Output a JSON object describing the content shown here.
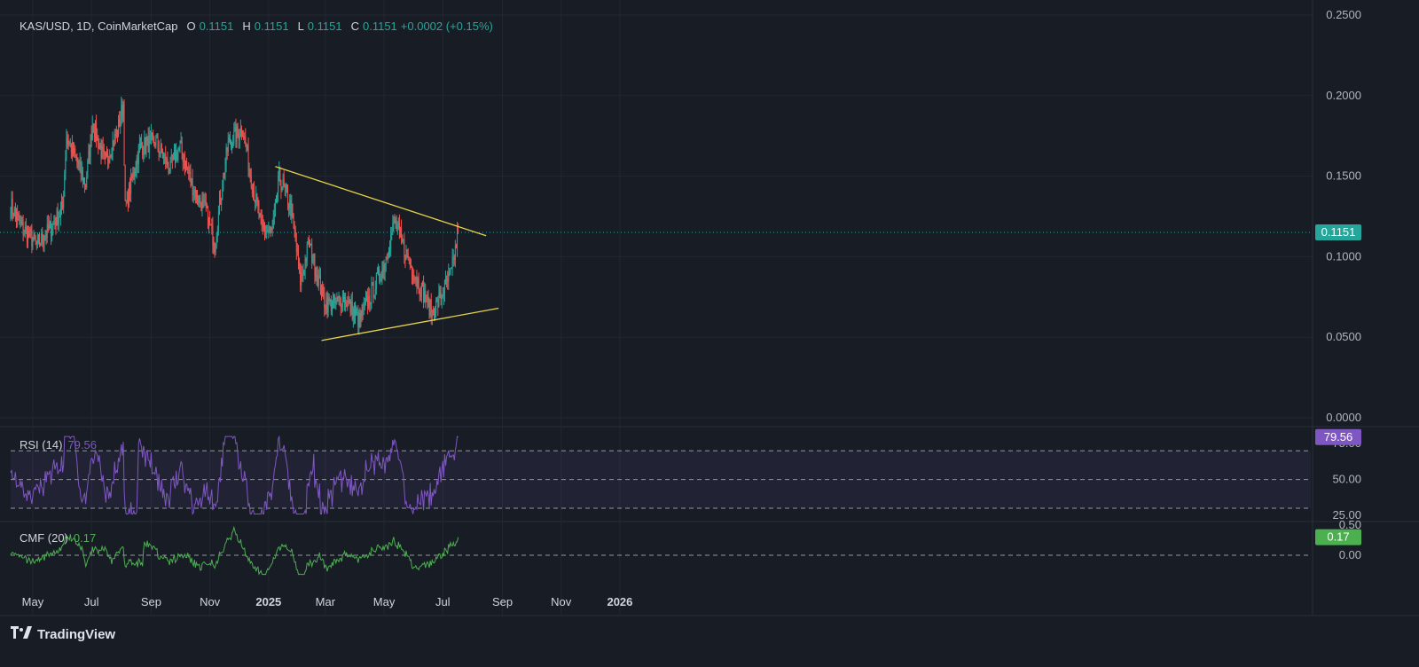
{
  "header": {
    "symbol": "KAS/USD, 1D, CoinMarketCap",
    "open_label": "O",
    "open": "0.1151",
    "high_label": "H",
    "high": "0.1151",
    "low_label": "L",
    "low": "0.1151",
    "close_label": "C",
    "close": "0.1151",
    "change": "+0.0002 (+0.15%)"
  },
  "colors": {
    "up": "#26a69a",
    "down": "#ef5350",
    "trendline": "#e5d34a",
    "rsi": "#7e57c2",
    "cmf": "#4caf50",
    "last_price": "#26a69a"
  },
  "footer": {
    "brand": "TradingView",
    "logo_icon": "tradingview-logo-icon"
  },
  "chart_data": [
    {
      "type": "candlestick",
      "title": "KAS/USD, 1D, CoinMarketCap",
      "y_ticks": [
        "0.2500",
        "0.2000",
        "0.1500",
        "0.1000",
        "0.0500",
        "0.0000"
      ],
      "ylim": [
        0,
        0.25
      ],
      "last_price_label": "0.1151",
      "x_ticks": [
        "May",
        "Jul",
        "Sep",
        "Nov",
        "2025",
        "Mar",
        "May",
        "Jul",
        "Sep",
        "Nov",
        "2026"
      ],
      "approx_close_path": [
        [
          "2024-04-08",
          0.132
        ],
        [
          "2024-04-20",
          0.118
        ],
        [
          "2024-05-05",
          0.107
        ],
        [
          "2024-05-20",
          0.118
        ],
        [
          "2024-06-01",
          0.13
        ],
        [
          "2024-06-05",
          0.175
        ],
        [
          "2024-06-15",
          0.16
        ],
        [
          "2024-06-25",
          0.145
        ],
        [
          "2024-07-02",
          0.183
        ],
        [
          "2024-07-15",
          0.158
        ],
        [
          "2024-07-28",
          0.178
        ],
        [
          "2024-08-03",
          0.195
        ],
        [
          "2024-08-05",
          0.13
        ],
        [
          "2024-08-20",
          0.168
        ],
        [
          "2024-09-05",
          0.172
        ],
        [
          "2024-09-20",
          0.155
        ],
        [
          "2024-10-01",
          0.168
        ],
        [
          "2024-10-15",
          0.142
        ],
        [
          "2024-10-28",
          0.128
        ],
        [
          "2024-11-06",
          0.108
        ],
        [
          "2024-11-15",
          0.15
        ],
        [
          "2024-11-20",
          0.17
        ],
        [
          "2024-12-05",
          0.18
        ],
        [
          "2024-12-15",
          0.145
        ],
        [
          "2024-12-25",
          0.117
        ],
        [
          "2025-01-05",
          0.115
        ],
        [
          "2025-01-12",
          0.15
        ],
        [
          "2025-01-25",
          0.128
        ],
        [
          "2025-02-03",
          0.085
        ],
        [
          "2025-02-12",
          0.108
        ],
        [
          "2025-02-28",
          0.072
        ],
        [
          "2025-03-10",
          0.07
        ],
        [
          "2025-03-20",
          0.075
        ],
        [
          "2025-04-05",
          0.06
        ],
        [
          "2025-04-20",
          0.08
        ],
        [
          "2025-05-01",
          0.095
        ],
        [
          "2025-05-12",
          0.122
        ],
        [
          "2025-05-25",
          0.1
        ],
        [
          "2025-06-05",
          0.085
        ],
        [
          "2025-06-20",
          0.065
        ],
        [
          "2025-07-01",
          0.078
        ],
        [
          "2025-07-10",
          0.09
        ],
        [
          "2025-07-17",
          0.1151
        ]
      ],
      "trendlines": [
        {
          "from": [
            "2025-01-08",
            0.156
          ],
          "to": [
            "2025-08-15",
            0.113
          ]
        },
        {
          "from": [
            "2025-02-25",
            0.048
          ],
          "to": [
            "2025-08-28",
            0.068
          ]
        }
      ]
    },
    {
      "type": "line",
      "title": "RSI (14)",
      "series": [
        {
          "name": "RSI (14)",
          "last": 79.56
        }
      ],
      "last_label": "79.56",
      "y_ticks": [
        "75.00",
        "50.00",
        "25.00"
      ],
      "ylim": [
        22,
        85
      ],
      "bands": [
        30,
        50,
        70
      ]
    },
    {
      "type": "line",
      "title": "CMF (20)",
      "series": [
        {
          "name": "CMF (20)",
          "last": 0.17
        }
      ],
      "last_label": "0.17",
      "y_ticks": [
        "0.50",
        "0.00"
      ],
      "ylim": [
        -0.3,
        0.3
      ],
      "zero_line": 0
    }
  ]
}
